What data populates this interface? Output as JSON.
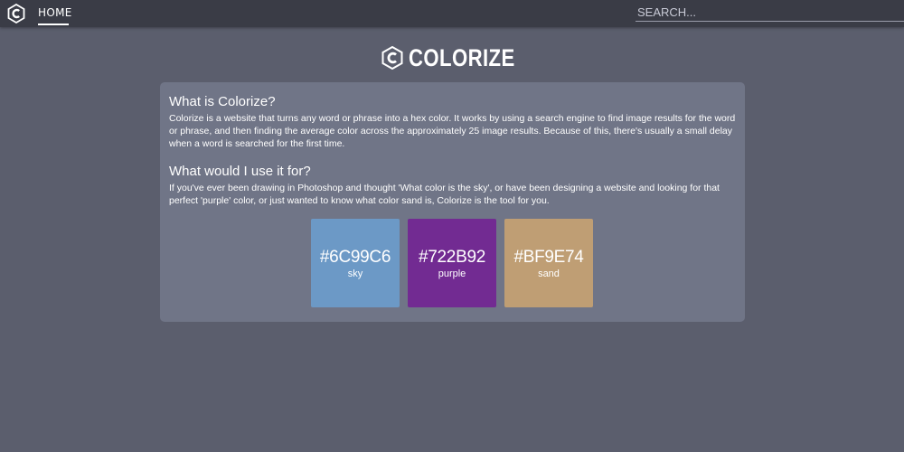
{
  "nav": {
    "home_label": "HOME",
    "logo_icon": "colorize-hexagon-c-icon"
  },
  "search": {
    "placeholder": "SEARCH..."
  },
  "header": {
    "title": "COLORIZE",
    "logo_icon": "colorize-hexagon-c-icon"
  },
  "card": {
    "section1": {
      "heading": "What is Colorize?",
      "body": "Colorize is a website that turns any word or phrase into a hex color. It works by using a search engine to find image results for the word or phrase, and then finding the average color across the approximately 25 image results. Because of this, there's usually a small delay when a word is searched for the first time."
    },
    "section2": {
      "heading": "What would I use it for?",
      "body": "If you've ever been drawing in Photoshop and thought 'What color is the sky', or have been designing a website and looking for that perfect 'purple' color, or just wanted to know what color sand is, Colorize is the tool for you."
    },
    "swatches": [
      {
        "hex": "#6C99C6",
        "name": "sky",
        "color": "#6C99C6"
      },
      {
        "hex": "#722B92",
        "name": "purple",
        "color": "#722B92"
      },
      {
        "hex": "#BF9E74",
        "name": "sand",
        "color": "#BF9E74"
      }
    ]
  },
  "colors": {
    "background": "#5b5e6d",
    "topbar": "#3a3c46",
    "card": "#707587"
  }
}
